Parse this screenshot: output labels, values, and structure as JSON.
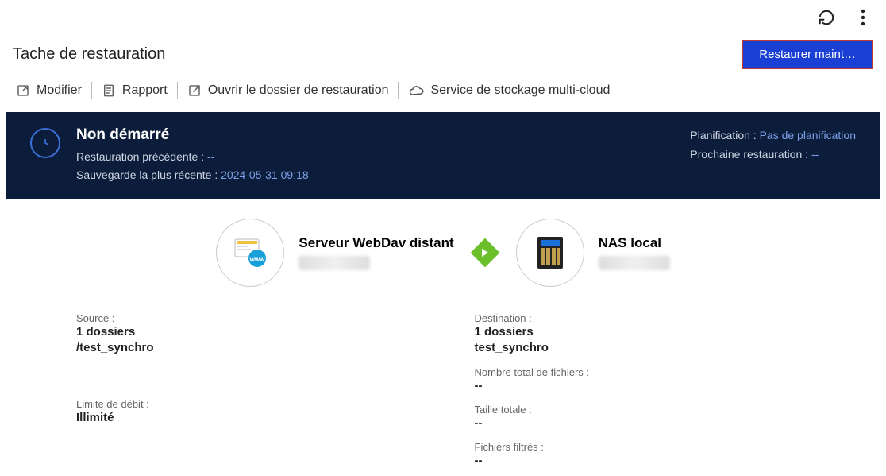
{
  "header": {
    "title": "Tache de restauration",
    "restore_button": "Restaurer maint…"
  },
  "actions": {
    "edit": "Modifier",
    "report": "Rapport",
    "open_folder": "Ouvrir le dossier de restauration",
    "multicloud": "Service de stockage multi-cloud"
  },
  "status": {
    "state": "Non démarré",
    "prev_label": "Restauration précédente :",
    "prev_value": "--",
    "latest_label": "Sauvegarde la plus récente :",
    "latest_value": "2024-05-31 09:18",
    "plan_label": "Planification :",
    "plan_value": "Pas de planification",
    "next_label": "Prochaine restauration :",
    "next_value": "--"
  },
  "source": {
    "name": "Serveur WebDav distant"
  },
  "destination": {
    "name": "NAS local"
  },
  "details": {
    "source_label": "Source :",
    "source_folders": "1 dossiers",
    "source_path": "/test_synchro",
    "rate_label": "Limite de débit :",
    "rate_value": "Illimité",
    "dest_label": "Destination :",
    "dest_folders": "1 dossiers",
    "dest_path": "test_synchro",
    "files_label": "Nombre total de fichiers :",
    "files_value": "--",
    "size_label": "Taille totale :",
    "size_value": "--",
    "filtered_label": "Fichiers filtrés :",
    "filtered_value": "--"
  }
}
